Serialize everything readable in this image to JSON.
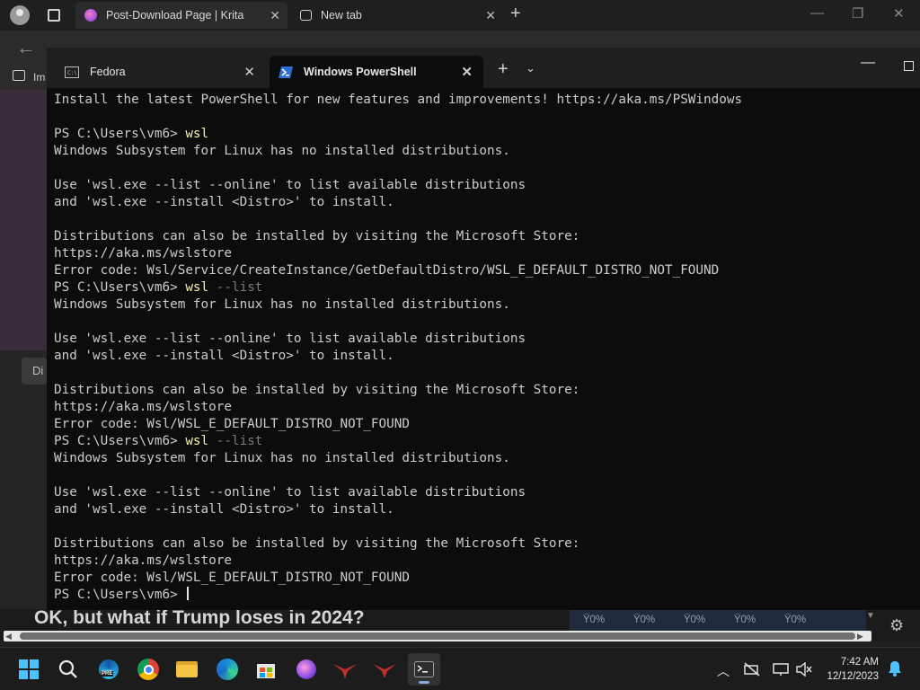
{
  "browser": {
    "tabs": [
      {
        "title": "Post-Download Page | Krita"
      },
      {
        "title": "New tab"
      }
    ],
    "favorites_label": "Im",
    "page_tab_label": "Di",
    "headline": "OK, but what if Trump loses in 2024?",
    "weather_values": [
      "Ÿ0%",
      "Ÿ0%",
      "Ÿ0%",
      "Ÿ0%",
      "Ÿ0%"
    ]
  },
  "terminal": {
    "tabs": [
      {
        "title": "Fedora"
      },
      {
        "title": "Windows PowerShell"
      }
    ],
    "lines": [
      [
        {
          "t": "Install the latest PowerShell for new features and improvements! https://aka.ms/PSWindows",
          "c": ""
        }
      ],
      [
        {
          "t": "",
          "c": ""
        }
      ],
      [
        {
          "t": "PS C:\\Users\\vm6> ",
          "c": ""
        },
        {
          "t": "wsl",
          "c": "cmd"
        }
      ],
      [
        {
          "t": "Windows Subsystem for Linux has no installed distributions.",
          "c": ""
        }
      ],
      [
        {
          "t": "",
          "c": ""
        }
      ],
      [
        {
          "t": "Use 'wsl.exe --list --online' to list available distributions",
          "c": ""
        }
      ],
      [
        {
          "t": "and 'wsl.exe --install <Distro>' to install.",
          "c": ""
        }
      ],
      [
        {
          "t": "",
          "c": ""
        }
      ],
      [
        {
          "t": "Distributions can also be installed by visiting the Microsoft Store:",
          "c": ""
        }
      ],
      [
        {
          "t": "https://aka.ms/wslstore",
          "c": ""
        }
      ],
      [
        {
          "t": "Error code: Wsl/Service/CreateInstance/GetDefaultDistro/WSL_E_DEFAULT_DISTRO_NOT_FOUND",
          "c": ""
        }
      ],
      [
        {
          "t": "PS C:\\Users\\vm6> ",
          "c": ""
        },
        {
          "t": "wsl",
          "c": "cmd"
        },
        {
          "t": " --list",
          "c": "param"
        }
      ],
      [
        {
          "t": "Windows Subsystem for Linux has no installed distributions.",
          "c": ""
        }
      ],
      [
        {
          "t": "",
          "c": ""
        }
      ],
      [
        {
          "t": "Use 'wsl.exe --list --online' to list available distributions",
          "c": ""
        }
      ],
      [
        {
          "t": "and 'wsl.exe --install <Distro>' to install.",
          "c": ""
        }
      ],
      [
        {
          "t": "",
          "c": ""
        }
      ],
      [
        {
          "t": "Distributions can also be installed by visiting the Microsoft Store:",
          "c": ""
        }
      ],
      [
        {
          "t": "https://aka.ms/wslstore",
          "c": ""
        }
      ],
      [
        {
          "t": "Error code: Wsl/WSL_E_DEFAULT_DISTRO_NOT_FOUND",
          "c": ""
        }
      ],
      [
        {
          "t": "PS C:\\Users\\vm6> ",
          "c": ""
        },
        {
          "t": "wsl",
          "c": "cmd"
        },
        {
          "t": " --list",
          "c": "param"
        }
      ],
      [
        {
          "t": "Windows Subsystem for Linux has no installed distributions.",
          "c": ""
        }
      ],
      [
        {
          "t": "",
          "c": ""
        }
      ],
      [
        {
          "t": "Use 'wsl.exe --list --online' to list available distributions",
          "c": ""
        }
      ],
      [
        {
          "t": "and 'wsl.exe --install <Distro>' to install.",
          "c": ""
        }
      ],
      [
        {
          "t": "",
          "c": ""
        }
      ],
      [
        {
          "t": "Distributions can also be installed by visiting the Microsoft Store:",
          "c": ""
        }
      ],
      [
        {
          "t": "https://aka.ms/wslstore",
          "c": ""
        }
      ],
      [
        {
          "t": "Error code: Wsl/WSL_E_DEFAULT_DISTRO_NOT_FOUND",
          "c": ""
        }
      ],
      [
        {
          "t": "PS C:\\Users\\vm6> ",
          "c": ""
        }
      ]
    ]
  },
  "taskbar": {
    "apps": [
      "start-icon",
      "search-icon",
      "edge-beta-icon",
      "chrome-icon",
      "file-explorer-icon",
      "edge-icon",
      "microsoft-store-icon",
      "krita-icon",
      "app-red-icon-1",
      "app-red-icon-2",
      "terminal-icon"
    ],
    "time": "7:42 AM",
    "date": "12/12/2023",
    "edge_badge": "PRE"
  },
  "colors": {
    "terminal_bg": "#0c0c0c",
    "command": "#f9f1a5",
    "parameter": "#7a7a7a",
    "text": "#cccccc"
  }
}
